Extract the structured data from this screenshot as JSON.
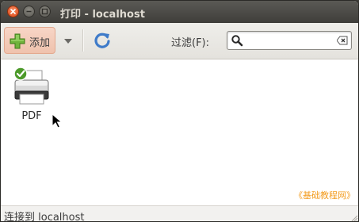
{
  "window": {
    "title": "打印 - localhost"
  },
  "toolbar": {
    "add_label": "添加",
    "filter_label": "过滤(F):",
    "search_value": ""
  },
  "printers": [
    {
      "name": "PDF",
      "icon": "printer-icon",
      "status": "default"
    }
  ],
  "watermark": "《基础教程网》",
  "statusbar": {
    "text": "连接到 localhost"
  },
  "colors": {
    "titlebar": "#4a4945",
    "close": "#df4a16",
    "add_button": "#f2c8b5",
    "watermark": "#f39c1f"
  }
}
